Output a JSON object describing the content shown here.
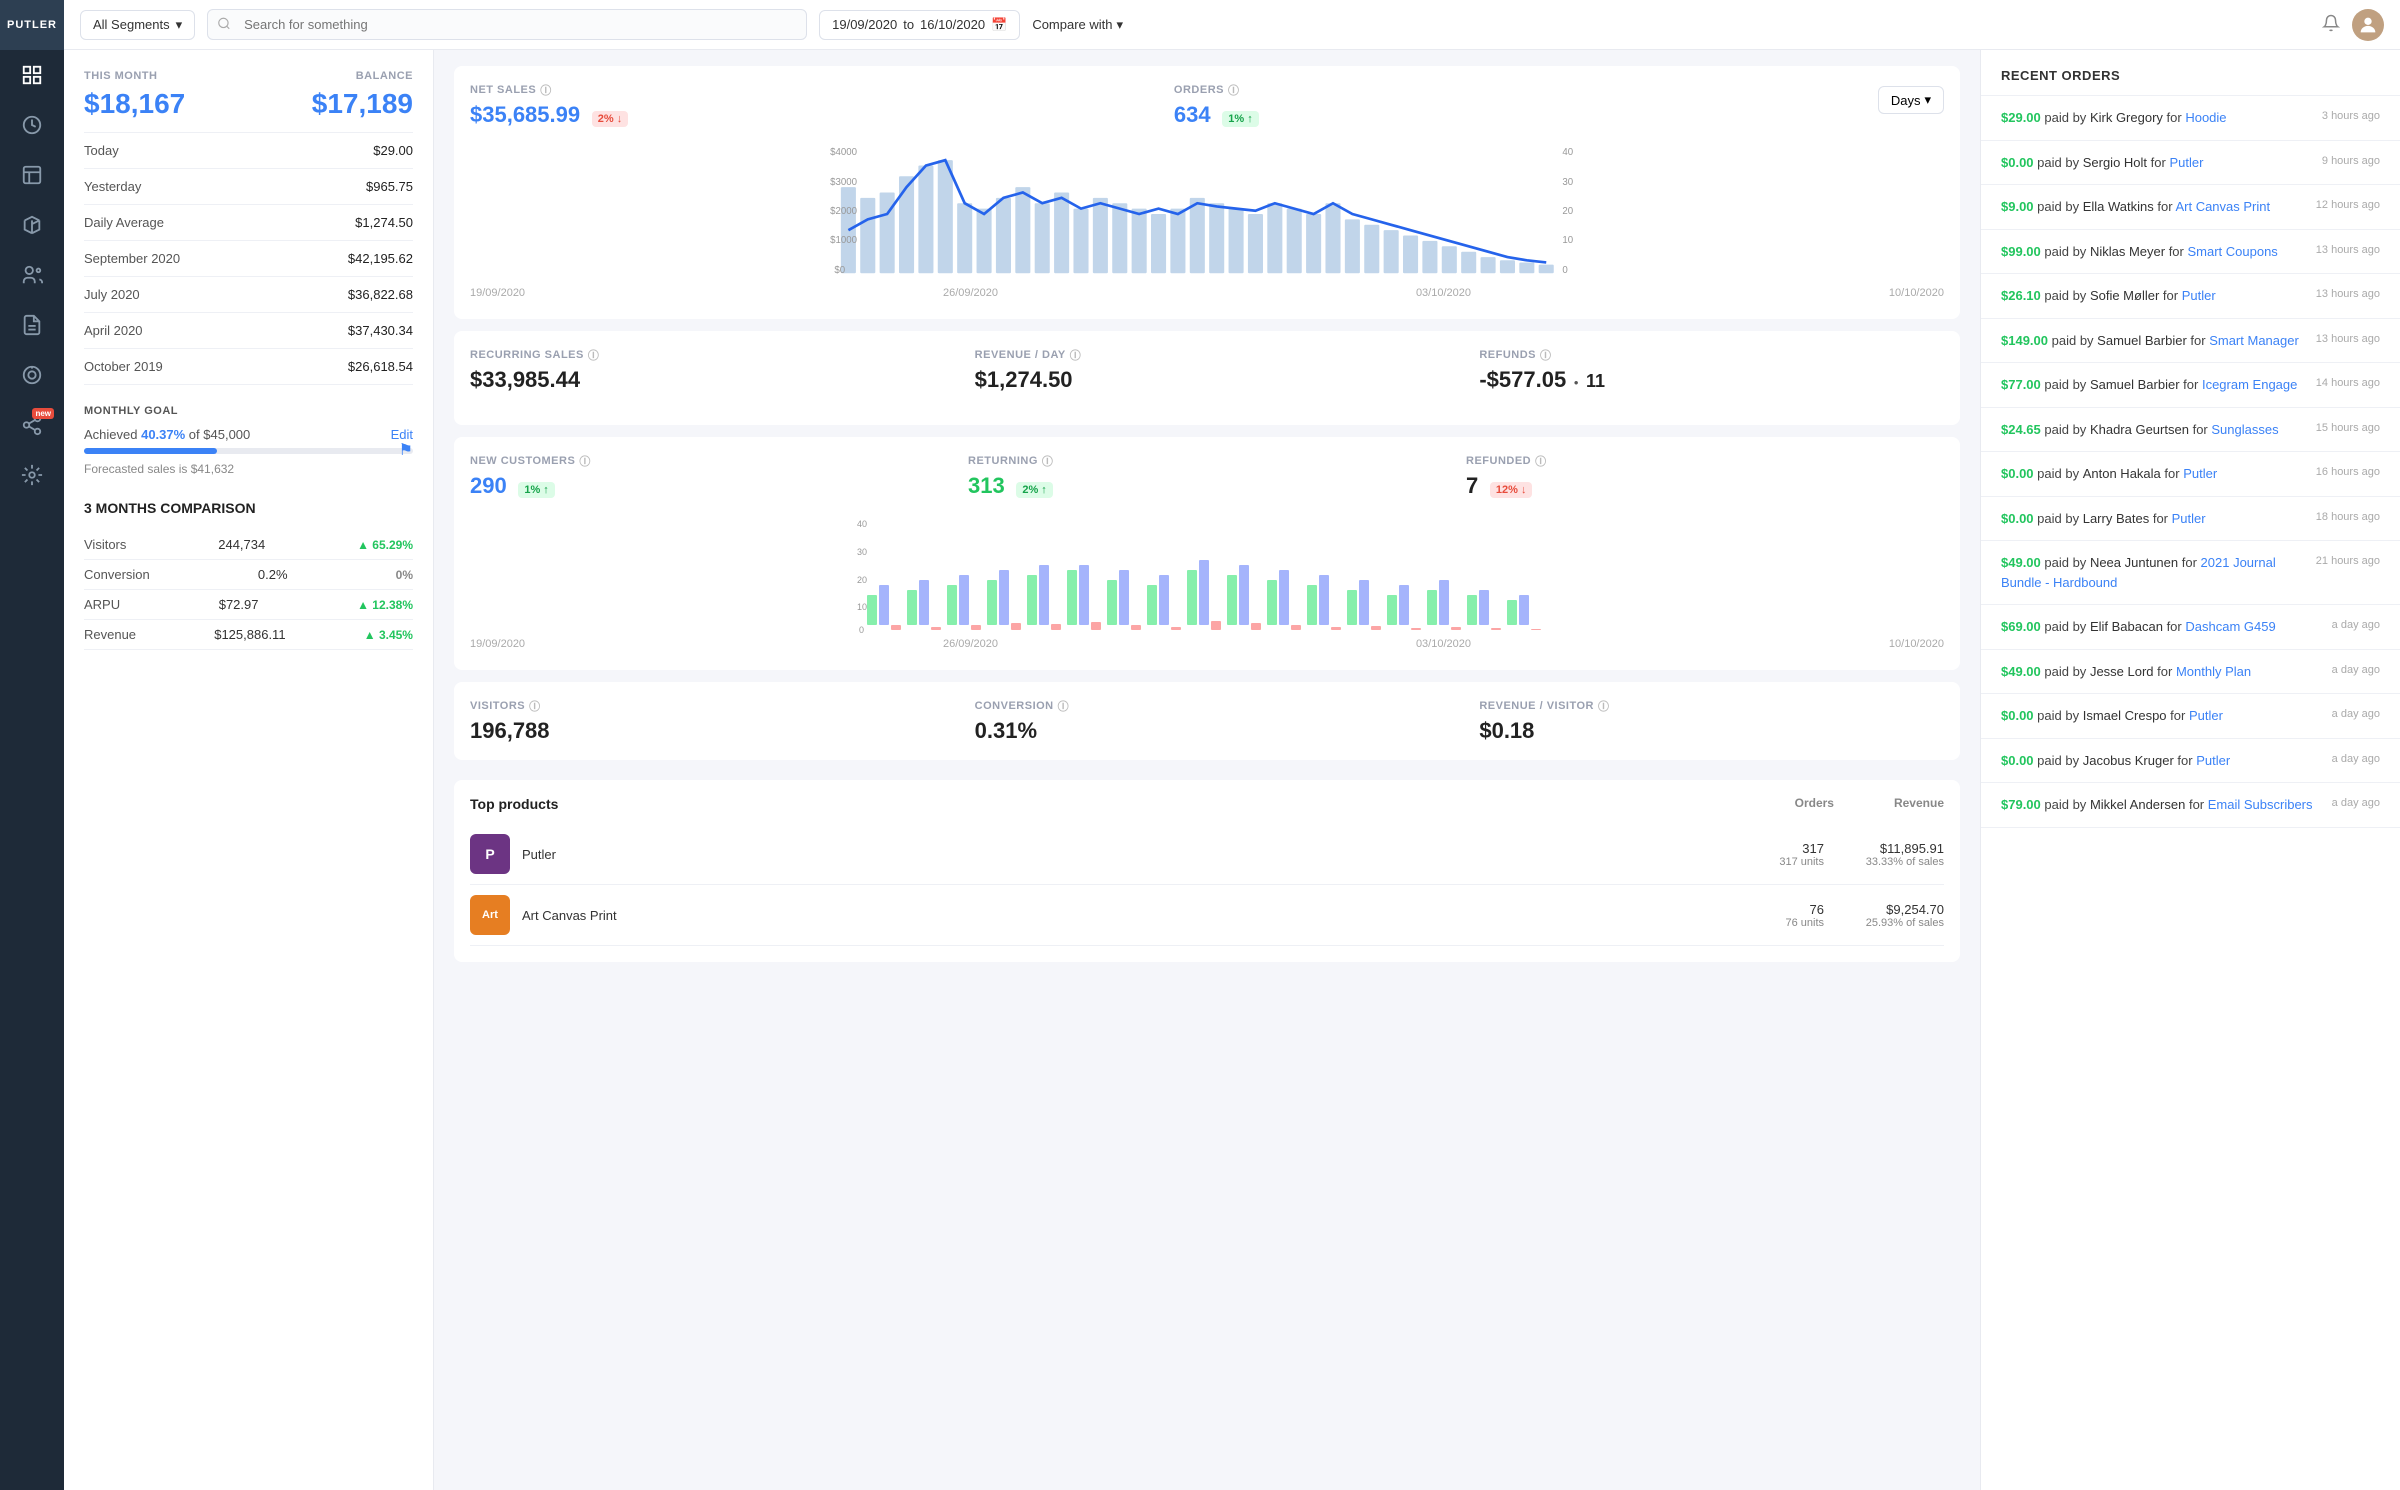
{
  "sidebar": {
    "logo": "PUTLER",
    "icons": [
      {
        "name": "dashboard-icon",
        "label": "Dashboard",
        "active": true
      },
      {
        "name": "sales-icon",
        "label": "Sales"
      },
      {
        "name": "orders-icon",
        "label": "Orders"
      },
      {
        "name": "products-icon",
        "label": "Products"
      },
      {
        "name": "customers-icon",
        "label": "Customers"
      },
      {
        "name": "reports-icon",
        "label": "Reports"
      },
      {
        "name": "goals-icon",
        "label": "Goals"
      },
      {
        "name": "affiliates-icon",
        "label": "Affiliates",
        "badge": "new"
      },
      {
        "name": "integrations-icon",
        "label": "Integrations"
      }
    ]
  },
  "topbar": {
    "segment": "All Segments",
    "search_placeholder": "Search for something",
    "date_from": "19/09/2020",
    "date_to": "16/10/2020",
    "compare_label": "Compare with"
  },
  "left_panel": {
    "this_month_label": "THIS MONTH",
    "balance_label": "BALANCE",
    "this_month_amount": "$18,167",
    "balance_amount": "$17,189",
    "stats": [
      {
        "label": "Today",
        "value": "$29.00"
      },
      {
        "label": "Yesterday",
        "value": "$965.75"
      },
      {
        "label": "Daily Average",
        "value": "$1,274.50"
      },
      {
        "label": "September 2020",
        "value": "$42,195.62"
      },
      {
        "label": "July 2020",
        "value": "$36,822.68"
      },
      {
        "label": "April 2020",
        "value": "$37,430.34"
      },
      {
        "label": "October 2019",
        "value": "$26,618.54"
      }
    ],
    "monthly_goal": {
      "title": "MONTHLY GOAL",
      "achieved_pct": "40.37%",
      "goal_amount": "$45,000",
      "edit_label": "Edit",
      "progress": 40.37,
      "forecast": "Forecasted sales is $41,632"
    },
    "comparison": {
      "title": "3 MONTHS COMPARISON",
      "rows": [
        {
          "metric": "Visitors",
          "value": "244,734",
          "change": "▲ 65.29%",
          "up": true
        },
        {
          "metric": "Conversion",
          "value": "0.2%",
          "change": "0%",
          "up": false
        },
        {
          "metric": "ARPU",
          "value": "$72.97",
          "change": "▲ 12.38%",
          "up": true
        },
        {
          "metric": "Revenue",
          "value": "$125,886.11",
          "change": "▲ 3.45%",
          "up": true
        }
      ]
    }
  },
  "main_metrics": {
    "net_sales": {
      "label": "NET SALES",
      "value": "$35,685.99",
      "badge": "2% ↓",
      "badge_type": "red"
    },
    "orders": {
      "label": "ORDERS",
      "value": "634",
      "badge": "1% ↑",
      "badge_type": "green"
    },
    "days_btn": "Days"
  },
  "chart_main": {
    "x_labels": [
      "19/09/2020",
      "26/09/2020",
      "03/10/2020",
      "10/10/2020"
    ],
    "y_labels": [
      "$4000",
      "$3000",
      "$2000",
      "$1000",
      "$0"
    ],
    "y_right": [
      "40",
      "30",
      "20",
      "10",
      "0"
    ]
  },
  "recurring_metrics": {
    "recurring_sales": {
      "label": "RECURRING SALES",
      "value": "$33,985.44"
    },
    "revenue_day": {
      "label": "REVENUE / DAY",
      "value": "$1,274.50"
    },
    "refunds": {
      "label": "REFUNDS",
      "value": "-$577.05",
      "count": "11"
    }
  },
  "customer_metrics": {
    "new_customers": {
      "label": "NEW CUSTOMERS",
      "value": "290",
      "badge": "1% ↑",
      "badge_type": "green"
    },
    "returning": {
      "label": "RETURNING",
      "value": "313",
      "badge": "2% ↑",
      "badge_type": "green"
    },
    "refunded": {
      "label": "REFUNDED",
      "value": "7",
      "badge": "12% ↓",
      "badge_type": "red"
    }
  },
  "visitor_metrics": {
    "visitors": {
      "label": "VISITORS",
      "value": "196,788"
    },
    "conversion": {
      "label": "CONVERSION",
      "value": "0.31%"
    },
    "revenue_visitor": {
      "label": "REVENUE / VISITOR",
      "value": "$0.18"
    }
  },
  "top_products": {
    "title": "Top products",
    "col_orders": "Orders",
    "col_revenue": "Revenue",
    "products": [
      {
        "name": "Putler",
        "color": "#6c3483",
        "orders": "317",
        "orders_sub": "317 units",
        "revenue": "$11,895.91",
        "revenue_sub": "33.33% of sales"
      },
      {
        "name": "Art Canvas Print",
        "color": "#e67e22",
        "orders": "76",
        "orders_sub": "76 units",
        "revenue": "$9,254.70",
        "revenue_sub": "25.93% of sales"
      }
    ]
  },
  "recent_orders": {
    "title": "RECENT ORDERS",
    "orders": [
      {
        "amount": "$29.00",
        "by": "Kirk Gregory",
        "product": "Hoodie",
        "time": "3 hours ago"
      },
      {
        "amount": "$0.00",
        "by": "Sergio Holt",
        "product": "Putler",
        "time": "9 hours ago"
      },
      {
        "amount": "$9.00",
        "by": "Ella Watkins",
        "product": "Art Canvas Print",
        "time": "12 hours ago"
      },
      {
        "amount": "$99.00",
        "by": "Niklas Meyer",
        "product": "Smart Coupons",
        "time": "13 hours ago"
      },
      {
        "amount": "$26.10",
        "by": "Sofie Møller",
        "product": "Putler",
        "time": "13 hours ago"
      },
      {
        "amount": "$149.00",
        "by": "Samuel Barbier",
        "product": "Smart Manager",
        "time": "13 hours ago"
      },
      {
        "amount": "$77.00",
        "by": "Samuel Barbier",
        "product": "Icegram Engage",
        "time": "14 hours ago"
      },
      {
        "amount": "$24.65",
        "by": "Khadra Geurtsen",
        "product": "Sunglasses",
        "time": "15 hours ago"
      },
      {
        "amount": "$0.00",
        "by": "Anton Hakala",
        "product": "Putler",
        "time": "16 hours ago"
      },
      {
        "amount": "$0.00",
        "by": "Larry Bates",
        "product": "Putler",
        "time": "18 hours ago"
      },
      {
        "amount": "$49.00",
        "by": "Neea Juntunen",
        "product": "2021 Journal Bundle - Hardbound",
        "time": "21 hours ago"
      },
      {
        "amount": "$69.00",
        "by": "Elif Babacan",
        "product": "Dashcam G459",
        "time": "a day ago"
      },
      {
        "amount": "$49.00",
        "by": "Jesse Lord",
        "product": "Monthly Plan",
        "time": "a day ago"
      },
      {
        "amount": "$0.00",
        "by": "Ismael Crespo",
        "product": "Putler",
        "time": "a day ago"
      },
      {
        "amount": "$0.00",
        "by": "Jacobus Kruger",
        "product": "Putler",
        "time": "a day ago"
      },
      {
        "amount": "$79.00",
        "by": "Mikkel Andersen",
        "product": "Email Subscribers",
        "time": "a day ago"
      }
    ]
  }
}
